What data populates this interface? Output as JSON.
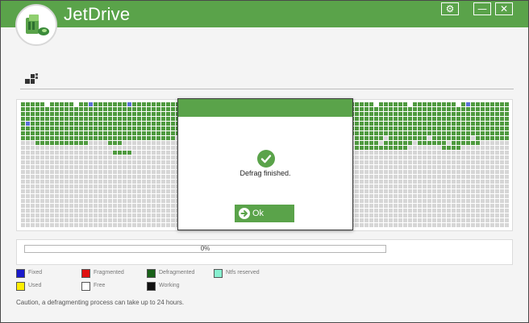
{
  "app": {
    "title": "JetDrive",
    "accent_color": "#5aa34a",
    "logo_icon": "jetdrive-logo-icon"
  },
  "window_controls": {
    "settings_icon": "gear-icon",
    "minimize_icon": "minimize-icon",
    "close_icon": "close-icon",
    "settings_glyph": "⚙",
    "minimize_glyph": "—",
    "close_glyph": "✕"
  },
  "toolbar": {
    "view_icon": "block-view-icon"
  },
  "dialog": {
    "message": "Defrag finished.",
    "ok_label": "Ok",
    "status_icon": "check-circle-icon",
    "ok_icon": "arrow-right-circle-icon"
  },
  "progress": {
    "value": 0,
    "label": "0%"
  },
  "legend": [
    {
      "label": "Fixed",
      "color": "#1a1acc"
    },
    {
      "label": "Used",
      "color": "#ffee00"
    },
    {
      "label": "Fragmented",
      "color": "#e01010"
    },
    {
      "label": "Free",
      "color": "#ffffff"
    },
    {
      "label": "Defragmented",
      "color": "#186018"
    },
    {
      "label": "Working",
      "color": "#111111"
    },
    {
      "label": "Ntfs reserved",
      "color": "#88f0d0"
    }
  ],
  "block_map": {
    "colors": {
      "defragmented": "#4f9a3f",
      "free": "#d6d6d6",
      "fixed": "#5b6fd6",
      "empty": "#ffffff"
    }
  },
  "caution": "Caution, a defragmenting process can take up to 24 hours."
}
